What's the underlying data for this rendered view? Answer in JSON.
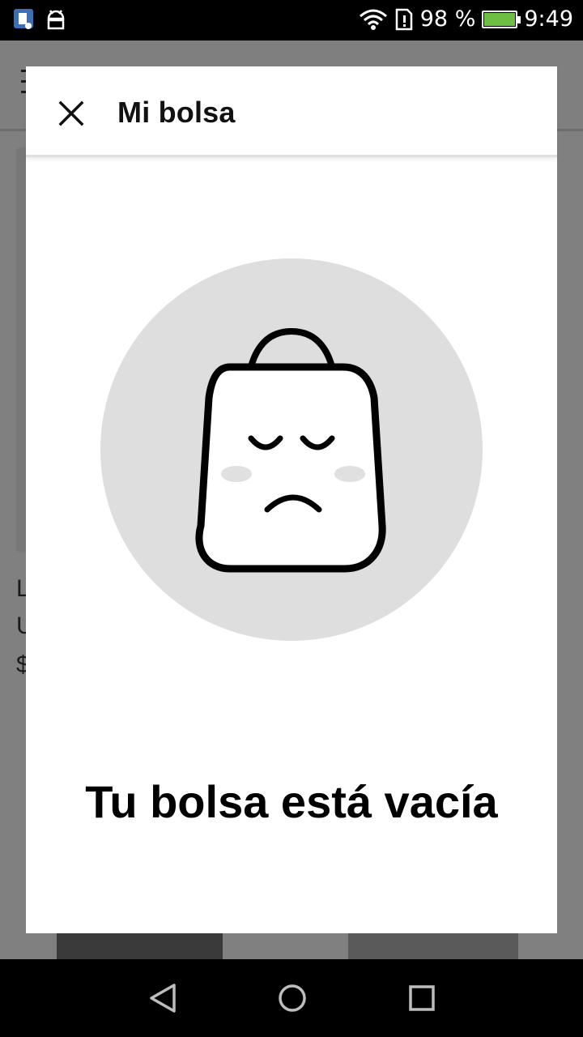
{
  "status_bar": {
    "battery_percent": "98 %",
    "battery_level": 0.98,
    "time": "9:49",
    "icons": [
      "screenshot-notification-icon",
      "android-debug-icon",
      "wifi-icon",
      "sim-alert-icon",
      "battery-charging-icon"
    ]
  },
  "background": {
    "peek_lines": [
      "L",
      "U",
      "$"
    ]
  },
  "modal": {
    "title": "Mi bolsa",
    "close_icon": "close-icon",
    "illustration_icon": "sad-shopping-bag-icon",
    "empty_message": "Tu bolsa está vacía"
  },
  "nav_bar": {
    "icons": [
      "back-icon",
      "home-icon",
      "recents-icon"
    ]
  },
  "colors": {
    "circle": "#dedede",
    "cheek": "#e0e0e0",
    "battery_fill": "#6fbe44"
  }
}
